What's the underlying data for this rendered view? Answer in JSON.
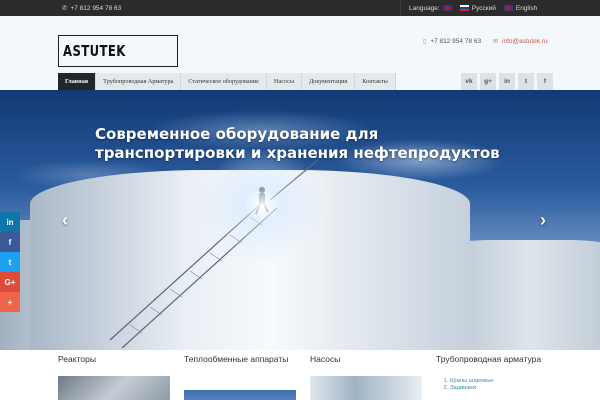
{
  "topbar": {
    "phone": "+7 812 954 78 63",
    "language_label": "Language:",
    "languages": [
      "Русский",
      "English"
    ]
  },
  "header": {
    "logo_text": "ASTUTEK",
    "phone": "+7 812 954 78 63",
    "email": "info@astutek.ru"
  },
  "nav": {
    "tabs": [
      "Главная",
      "Трубопроводная Арматура",
      "Статическое оборудование",
      "Насосы",
      "Документация",
      "Контакты"
    ],
    "active_index": 0
  },
  "socials": [
    "vk",
    "g+",
    "in",
    "tw",
    "f"
  ],
  "hero": {
    "title": "Современное оборудование для транспортировки и хранения нефтепродуктов",
    "prev_label": "‹",
    "next_label": "›"
  },
  "share": [
    {
      "label": "in",
      "color": "#0e76a8"
    },
    {
      "label": "f",
      "color": "#3b5998"
    },
    {
      "label": "t",
      "color": "#1da1f2"
    },
    {
      "label": "G+",
      "color": "#dd4b39"
    },
    {
      "label": "+",
      "color": "#f0644b"
    }
  ],
  "bottom": {
    "columns": [
      {
        "title": "Реакторы"
      },
      {
        "title": "Теплообменные аппараты"
      },
      {
        "title": "Насосы"
      },
      {
        "title": "Трубопроводная арматура",
        "items": [
          "Краны шаровые",
          "Задвижки"
        ]
      }
    ]
  },
  "colors": {
    "topbar_bg": "#2b2b2b",
    "nav_active": "#22262b",
    "link": "#3a8fb7",
    "email": "#d9534f"
  }
}
